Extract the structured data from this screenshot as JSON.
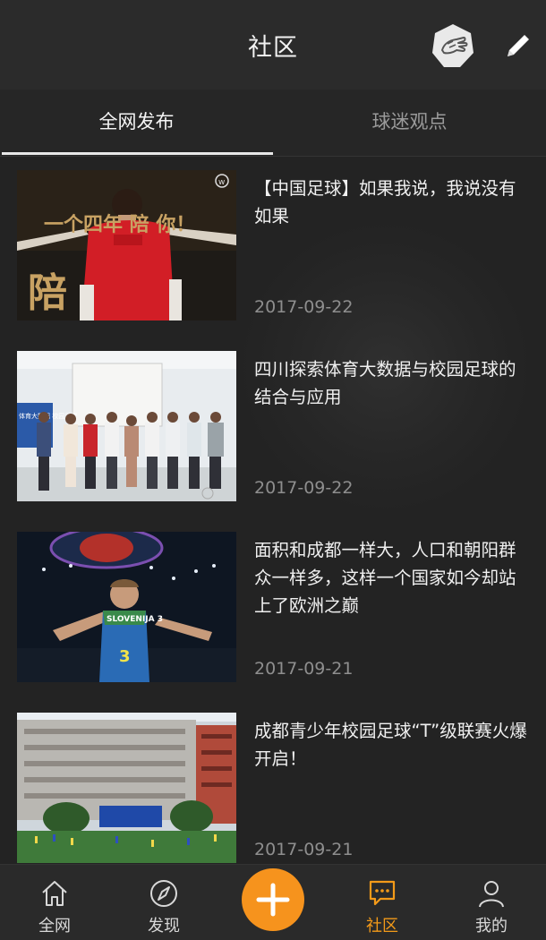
{
  "header": {
    "title": "社区",
    "badge_icon": "hand-badge-icon",
    "edit_icon": "pencil-icon"
  },
  "tabs": [
    {
      "label": "全网发布",
      "active": true
    },
    {
      "label": "球迷观点",
      "active": false
    }
  ],
  "articles": [
    {
      "title": "【中国足球】如果我说，我说没有如果",
      "date": "2017-09-22",
      "image_caption": "一个四年 陪 你！"
    },
    {
      "title": "四川探索体育大数据与校园足球的结合与应用",
      "date": "2017-09-22",
      "image_caption": "体育大数据 校园足球"
    },
    {
      "title": "面积和成都一样大，人口和朝阳群众一样多，这样一个国家如今却站上了欧洲之巅",
      "date": "2017-09-21",
      "image_caption": "SLOVENIJA 3"
    },
    {
      "title": "成都青少年校园足球“T”级联赛火爆开启！",
      "date": "2017-09-21",
      "image_caption": ""
    }
  ],
  "bottom_nav": [
    {
      "label": "全网",
      "icon": "home-icon",
      "active": false
    },
    {
      "label": "发现",
      "icon": "compass-icon",
      "active": false
    },
    {
      "label": "",
      "icon": "plus-icon",
      "active": false
    },
    {
      "label": "社区",
      "icon": "chat-icon",
      "active": true
    },
    {
      "label": "我的",
      "icon": "person-icon",
      "active": false
    }
  ],
  "colors": {
    "accent": "#f6931d",
    "background": "#232323",
    "header": "#2b2b2b"
  }
}
